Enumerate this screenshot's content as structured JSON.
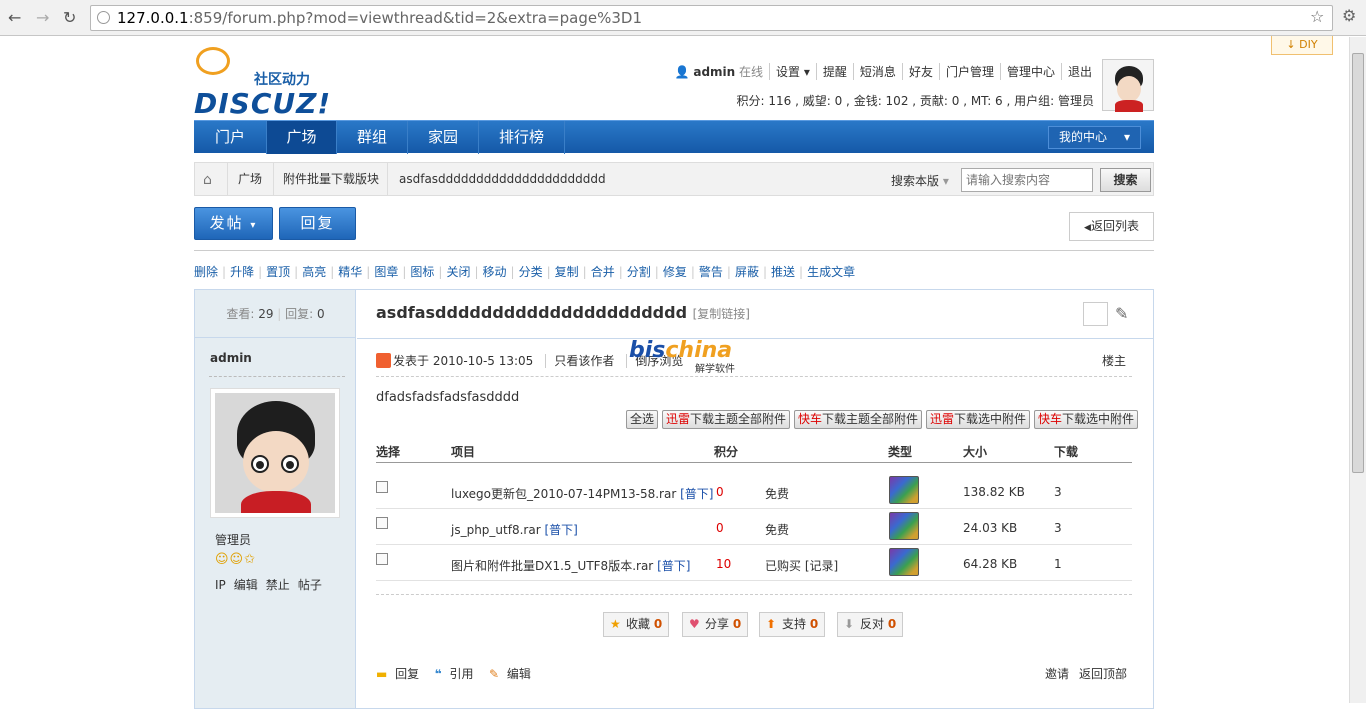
{
  "browser": {
    "url_host": "127.0.0.1",
    "url_rest": ":859/forum.php?mod=viewthread&tid=2&extra=page%3D1"
  },
  "diy": "↓ DIY",
  "logo": {
    "sub": "社区动力",
    "main": "DISCUZ!"
  },
  "userbar": {
    "username": "admin",
    "online": "在线",
    "items": [
      "设置",
      "提醒",
      "短消息",
      "好友",
      "门户管理",
      "管理中心",
      "退出"
    ]
  },
  "credits": "积分: 116 , 威望: 0 , 金钱: 102 , 贡献: 0 , MT: 6 , 用户组: 管理员",
  "nav": {
    "tabs": [
      "门户",
      "广场",
      "群组",
      "家园",
      "排行榜"
    ],
    "mycenter": "我的中心"
  },
  "breadcrumb": {
    "items": [
      "广场",
      "附件批量下载版块",
      "asdfasdddddddddddddddddddddd"
    ]
  },
  "search": {
    "label": "搜索本版",
    "placeholder": "请输入搜索内容",
    "button": "搜索"
  },
  "actions": {
    "post": "发帖",
    "reply": "回复",
    "back": "返回列表"
  },
  "mod": [
    "删除",
    "升降",
    "置顶",
    "高亮",
    "精华",
    "图章",
    "图标",
    "关闭",
    "移动",
    "分类",
    "复制",
    "合并",
    "分割",
    "修复",
    "警告",
    "屏蔽",
    "推送",
    "生成文章"
  ],
  "side": {
    "views_label": "查看:",
    "views": "29",
    "replies_label": "回复:",
    "replies": "0",
    "author": "admin",
    "group": "管理员",
    "stars": "☺☺✩",
    "links": [
      "IP",
      "编辑",
      "禁止",
      "帖子"
    ]
  },
  "post": {
    "title": "asdfasdddddddddddddddddddddd",
    "copy": "[复制链接]",
    "date": "发表于 2010-10-5 13:05",
    "only_author": "只看该作者",
    "reverse": "倒序浏览",
    "floor": "楼主",
    "message": "dfadsfadsfadsfasdddd"
  },
  "watermark": {
    "a": "bis",
    "b": "china",
    "sub": "解学软件"
  },
  "dl": {
    "select_all": "全选",
    "b1a": "迅雷",
    "b1b": "下载主题全部附件",
    "b2a": "快车",
    "b2b": "下载主题全部附件",
    "b3a": "迅雷",
    "b3b": "下载选中附件",
    "b4a": "快车",
    "b4b": "下载选中附件"
  },
  "att_head": [
    "选择",
    "项目",
    "积分",
    "类型",
    "大小",
    "下载"
  ],
  "attachments": [
    {
      "name": "luxego更新包_2010-07-14PM13-58.rar",
      "tag": "[普下]",
      "credit": "0",
      "status": "免费",
      "size": "138.82 KB",
      "downloads": "3"
    },
    {
      "name": "js_php_utf8.rar",
      "tag": "[普下]",
      "credit": "0",
      "status": "免费",
      "size": "24.03 KB",
      "downloads": "3"
    },
    {
      "name": "图片和附件批量DX1.5_UTF8版本.rar",
      "tag": "[普下]",
      "credit": "10",
      "status": "已购买 [记录]",
      "size": "64.28 KB",
      "downloads": "1"
    }
  ],
  "reactions": [
    {
      "label": "收藏",
      "count": "0"
    },
    {
      "label": "分享",
      "count": "0"
    },
    {
      "label": "支持",
      "count": "0"
    },
    {
      "label": "反对",
      "count": "0"
    }
  ],
  "footer": {
    "reply": "回复",
    "quote": "引用",
    "edit": "编辑",
    "invite": "邀请",
    "top": "返回顶部"
  }
}
